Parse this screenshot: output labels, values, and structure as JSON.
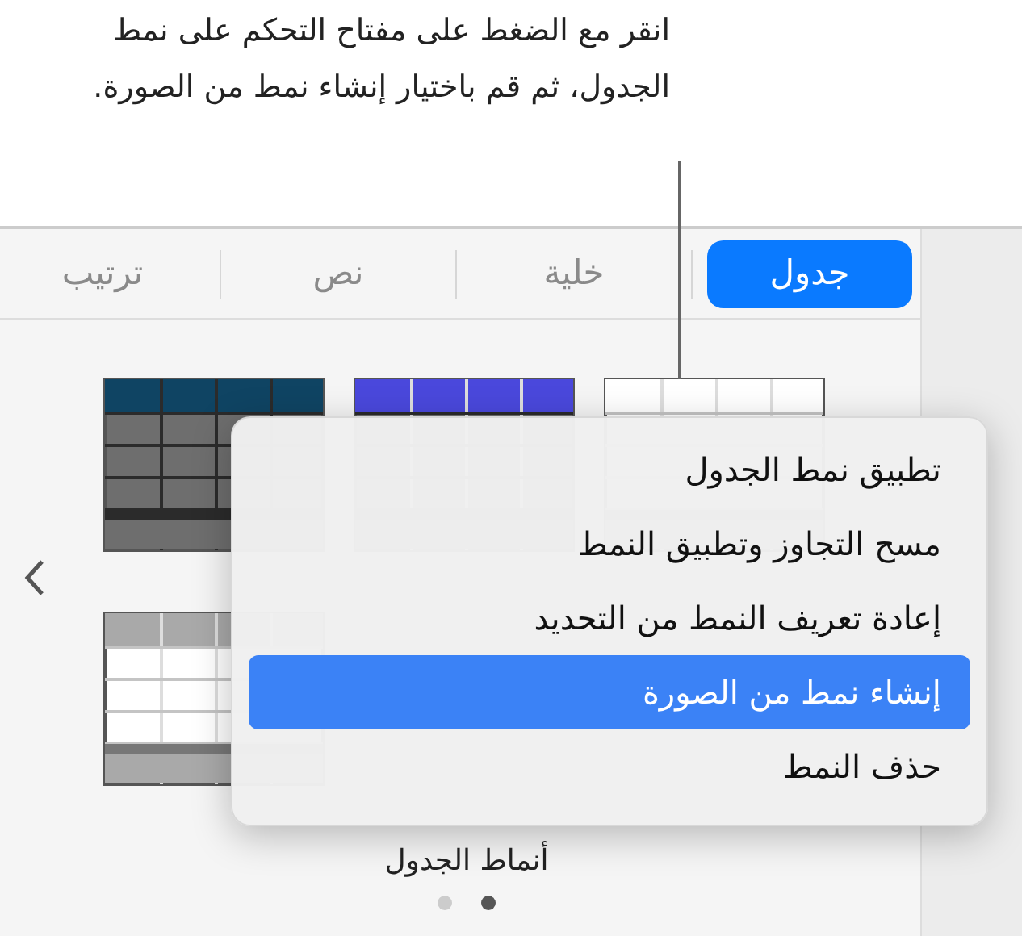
{
  "callout": "انقر مع الضغط على مفتاح التحكم على نمط الجدول، ثم قم باختيار إنشاء نمط من الصورة.",
  "tabs": [
    {
      "label": "جدول",
      "selected": true
    },
    {
      "label": "خلية",
      "selected": false
    },
    {
      "label": "نص",
      "selected": false
    },
    {
      "label": "ترتيب",
      "selected": false
    }
  ],
  "table_styles": [
    {
      "kind": "filled",
      "color": "#0f4463"
    },
    {
      "kind": "filled",
      "color": "#4a48dc"
    },
    {
      "kind": "light",
      "color": "#ffffff"
    },
    {
      "kind": "light",
      "color": "#a9a9a9"
    }
  ],
  "section_label": "أنماط الجدول",
  "pages": [
    {
      "selected": false
    },
    {
      "selected": true
    }
  ],
  "context_menu": [
    {
      "label": "تطبيق نمط الجدول",
      "selected": false
    },
    {
      "label": "مسح التجاوز وتطبيق النمط",
      "selected": false
    },
    {
      "label": "إعادة تعريف النمط من التحديد",
      "selected": false
    },
    {
      "label": "إنشاء نمط من الصورة",
      "selected": true
    },
    {
      "label": "حذف النمط",
      "selected": false
    }
  ]
}
